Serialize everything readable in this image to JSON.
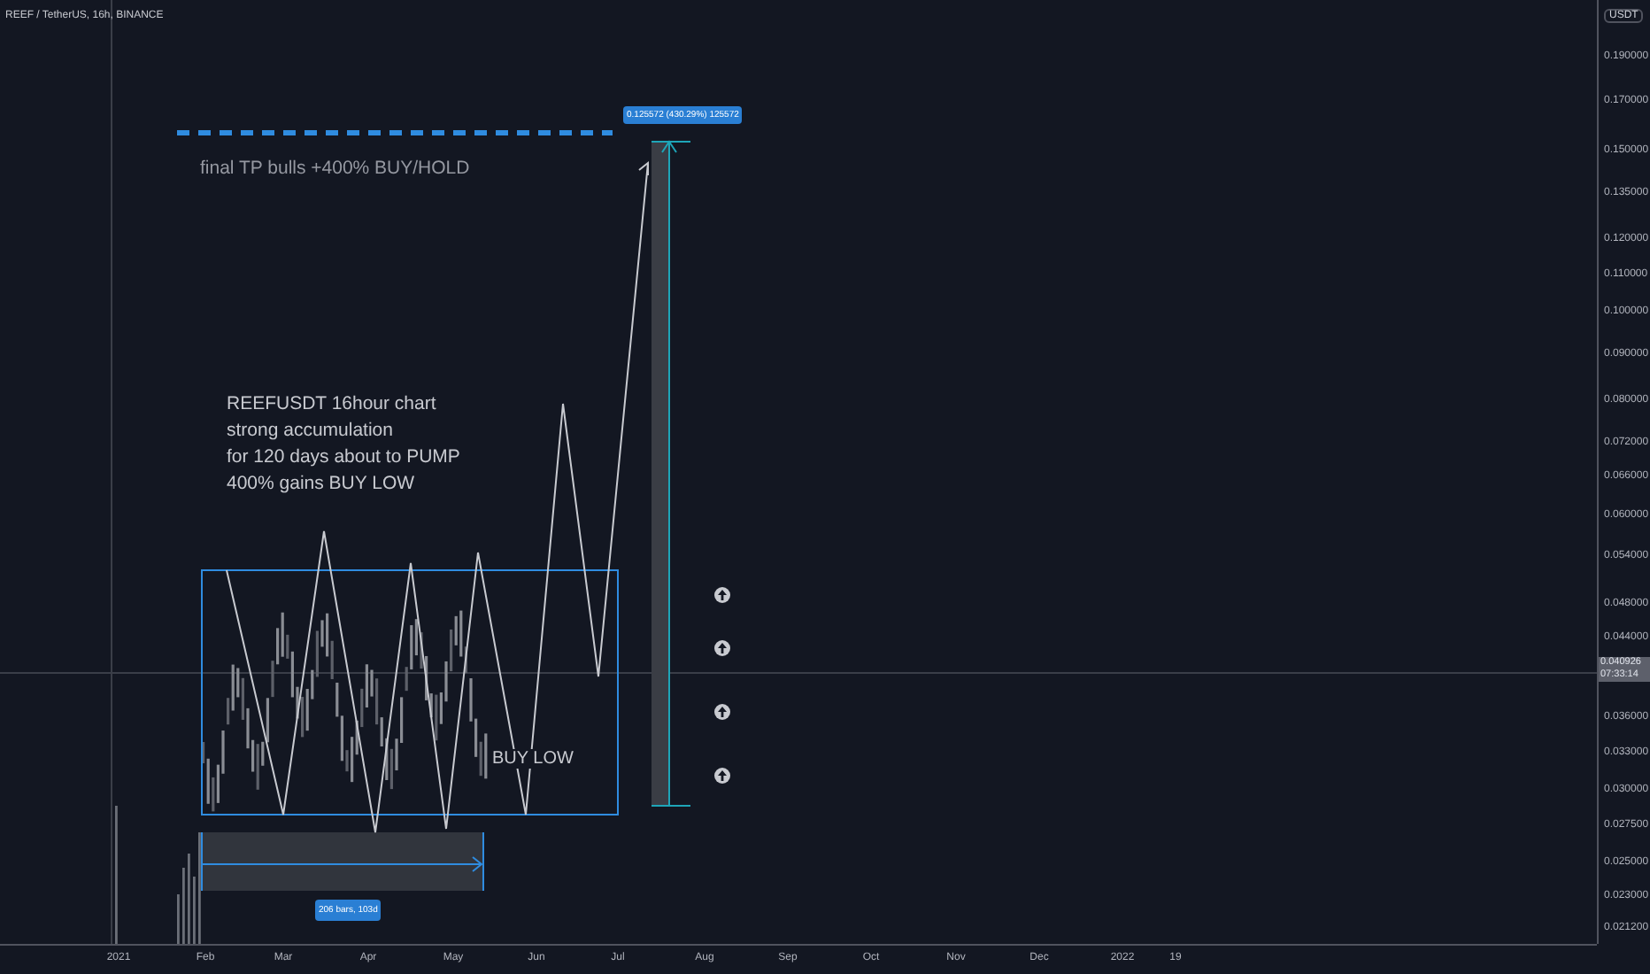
{
  "symbol_title": "REEF / TetherUS, 16h, BINANCE",
  "annotations": {
    "target_note": "final TP bulls +400% BUY/HOLD",
    "range_label": "0.125572 (430.29%) 125572",
    "main_note": [
      "REEFUSDT 16hour chart",
      "strong accumulation",
      "for 120 days about to PUMP",
      "400% gains BUY LOW"
    ],
    "buy_low": "BUY LOW",
    "date_range_label": "206 bars, 103d"
  },
  "price_axis": {
    "unit": "USDT",
    "labels": [
      "0.190000",
      "0.170000",
      "0.150000",
      "0.135000",
      "0.120000",
      "0.110000",
      "0.100000",
      "0.090000",
      "0.080000",
      "0.072000",
      "0.066000",
      "0.060000",
      "0.054000",
      "0.048000",
      "0.044000",
      "0.036000",
      "0.033000",
      "0.030000",
      "0.027500",
      "0.025000",
      "0.023000",
      "0.021200"
    ],
    "current": {
      "price": "0.040926",
      "countdown": "07:33:14"
    }
  },
  "time_axis": {
    "labels": [
      "2021",
      "Feb",
      "Mar",
      "Apr",
      "May",
      "Jun",
      "Jul",
      "Aug",
      "Sep",
      "Oct",
      "Nov",
      "Dec",
      "2022",
      "19"
    ]
  }
}
